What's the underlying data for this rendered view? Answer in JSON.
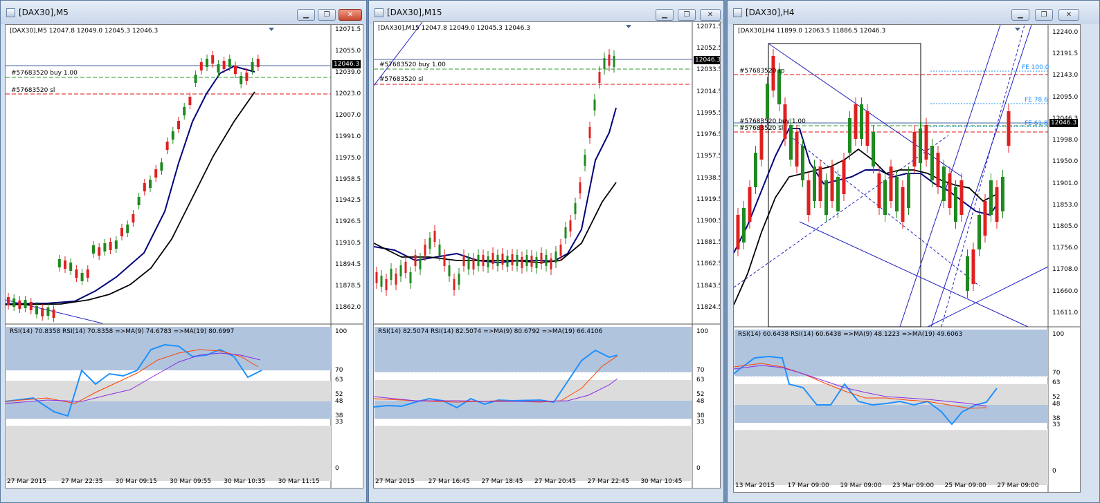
{
  "windows": [
    {
      "id": "m5",
      "title": "[DAX30],M5",
      "header_line": "[DAX30],M5  12047.8 12049.0 12045.3 12046.3",
      "price_current": "12046.3",
      "price_axis": [
        "12071.5",
        "12055.0",
        "12039.0",
        "12023.0",
        "12007.0",
        "11991.0",
        "11975.0",
        "11958.5",
        "11942.5",
        "11926.5",
        "11910.5",
        "11894.5",
        "11878.5",
        "11862.0"
      ],
      "order_labels": [
        "#57683520 buy 1.00",
        "#57683520 sl"
      ],
      "rsi_header": "RSI(14) 70.8358  RSI(14) 70.8358  =>MA(9) 74.6783  =>MA(19) 80.6997",
      "rsi_levels": [
        "100",
        "70",
        "63",
        "52",
        "48",
        "38",
        "33",
        "0"
      ],
      "time_labels": [
        "27 Mar 2015",
        "27 Mar 22:35",
        "30 Mar 09:15",
        "30 Mar 09:55",
        "30 Mar 10:35",
        "30 Mar 11:15"
      ]
    },
    {
      "id": "m15",
      "title": "[DAX30],M15",
      "header_line": "[DAX30],M15  12047.8 12049.0 12045.3 12046.3",
      "price_current": "12046.3",
      "price_axis": [
        "12071.5",
        "12052.5",
        "12033.5",
        "12014.5",
        "11995.5",
        "11976.5",
        "11957.5",
        "11938.5",
        "11919.5",
        "11900.5",
        "11881.5",
        "11862.5",
        "11843.5",
        "11824.5"
      ],
      "order_labels": [
        "#57683520 buy 1.00",
        "#57683520 sl"
      ],
      "rsi_header": "RSI(14) 82.5074  RSI(14) 82.5074  =>MA(9) 80.6792  =>MA(19) 66.4106",
      "rsi_levels": [
        "100",
        "70",
        "63",
        "52",
        "48",
        "38",
        "33",
        "0"
      ],
      "time_labels": [
        "27 Mar 2015",
        "27 Mar 16:45",
        "27 Mar 18:45",
        "27 Mar 20:45",
        "27 Mar 22:45",
        "30 Mar 10:45"
      ]
    },
    {
      "id": "h4",
      "title": "[DAX30],H4",
      "header_line": "[DAX30],H4  11899.0 12063.5 11886.5 12046.3",
      "price_current": "12046.3",
      "price_axis": [
        "12240.0",
        "12191.5",
        "12143.0",
        "12095.0",
        "12046.3",
        "11998.0",
        "11950.0",
        "11901.0",
        "11853.0",
        "11805.0",
        "11756.0",
        "11708.0",
        "11660.0",
        "11611.0"
      ],
      "order_labels": [
        "#57683520 tp",
        "#57683520 buy 1.00",
        "#57683520 sl"
      ],
      "fe_labels": [
        "FE 100.0",
        "FE 78.6",
        "FE 61.8"
      ],
      "rsi_header": "RSI(14) 60.6438  RSI(14) 60.6438  =>MA(9) 48.1223  =>MA(19) 49.6063",
      "rsi_levels": [
        "100",
        "70",
        "63",
        "52",
        "48",
        "38",
        "33",
        "0"
      ],
      "time_labels": [
        "13 Mar 2015",
        "17 Mar 09:00",
        "19 Mar 09:00",
        "23 Mar 09:00",
        "25 Mar 09:00",
        "27 Mar 09:00"
      ]
    }
  ],
  "colors": {
    "bull": "#1f8a1f",
    "bear": "#e02020",
    "ma_fast": "#00007a",
    "ma_slow": "#000000",
    "rsi": "#1e90ff",
    "rsi_ma9": "#ff4500",
    "rsi_ma19": "#8a2be2",
    "buy_line": "#2a9a2a",
    "sl_line": "#e01010",
    "band": "#b0c4de"
  },
  "window_buttons": {
    "minimize": "minimize",
    "restore": "restore",
    "close": "close"
  }
}
